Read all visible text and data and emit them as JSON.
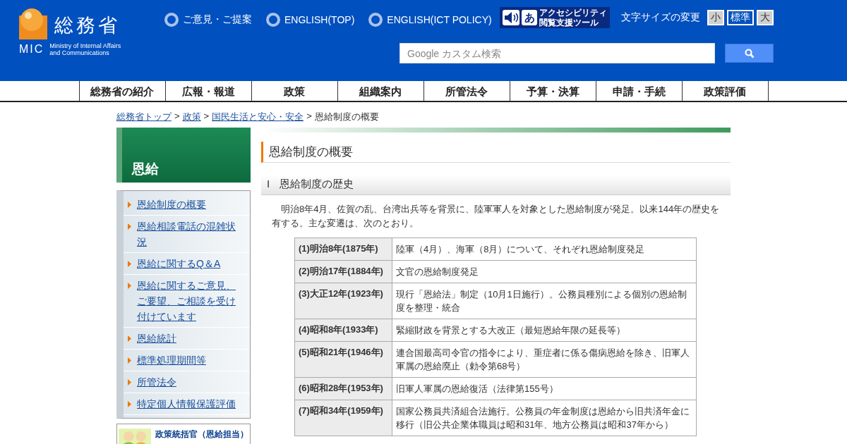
{
  "header": {
    "logo": {
      "name": "総務省",
      "abbr": "MIC",
      "english_lines": [
        "Ministry of Internal Affairs",
        "and Communications"
      ]
    },
    "links": [
      "ご意見・ご提案",
      "ENGLISH(TOP)",
      "ENGLISH(ICT POLICY)"
    ],
    "accessibility_tool": {
      "glyph": "あ",
      "lines": [
        "アクセシビリティ",
        "閲覧支援ツール"
      ]
    },
    "font_size": {
      "label": "文字サイズの変更",
      "options": [
        {
          "label": "小",
          "selected": false
        },
        {
          "label": "標準",
          "selected": true
        },
        {
          "label": "大",
          "selected": false
        }
      ]
    },
    "search": {
      "placeholder": "Google カスタム検索"
    }
  },
  "nav": [
    "総務省の紹介",
    "広報・報道",
    "政策",
    "組織案内",
    "所管法令",
    "予算・決算",
    "申請・手続",
    "政策評価"
  ],
  "breadcrumb": {
    "separator": ">",
    "links": [
      "総務省トップ",
      "政策",
      "国民生活と安心・安全"
    ],
    "current": "恩給制度の概要"
  },
  "sidebar": {
    "title": "恩給",
    "items": [
      "恩給制度の概要",
      "恩給相談電話の混雑状況",
      "恩給に関するQ＆A",
      "恩給に関するご意見、ご要望、ご相談を受け付けています",
      "恩給統計",
      "標準処理期間等",
      "所管法令",
      "特定個人情報保護評価"
    ],
    "banner": {
      "lines": [
        "政策統括官（恩給担当）"
      ]
    }
  },
  "main": {
    "title": "恩給制度の概要",
    "section": {
      "number": "I",
      "title": "恩給制度の歴史"
    },
    "paragraph": "明治8年4月、佐賀の乱、台湾出兵等を背景に、陸軍軍人を対象とした恩給制度が発足。以来144年の歴史を有する。主な変遷は、次のとおり。",
    "history": [
      {
        "era": "(1)明治8年(1875年)",
        "event": "陸軍（4月）、海軍（8月）について、それぞれ恩給制度発足"
      },
      {
        "era": "(2)明治17年(1884年)",
        "event": "文官の恩給制度発足"
      },
      {
        "era": "(3)大正12年(1923年)",
        "event": "現行「恩給法」制定（10月1日施行）。公務員種別による個別の恩給制度を整理・統合"
      },
      {
        "era": "(4)昭和8年(1933年)",
        "event": "緊縮財政を背景とする大改正（最短恩給年限の延長等）"
      },
      {
        "era": "(5)昭和21年(1946年)",
        "event": "連合国最高司令官の指令により、重症者に係る傷病恩給を除き、旧軍人軍属の恩給廃止（勅令第68号）"
      },
      {
        "era": "(6)昭和28年(1953年)",
        "event": "旧軍人軍属の恩給復活（法律第155号）"
      },
      {
        "era": "(7)昭和34年(1959年)",
        "event": "国家公務員共済組合法施行。公務員の年金制度は恩給から旧共済年金に移行（旧公共企業体職員は昭和31年、地方公務員は昭和37年から）"
      }
    ]
  }
}
